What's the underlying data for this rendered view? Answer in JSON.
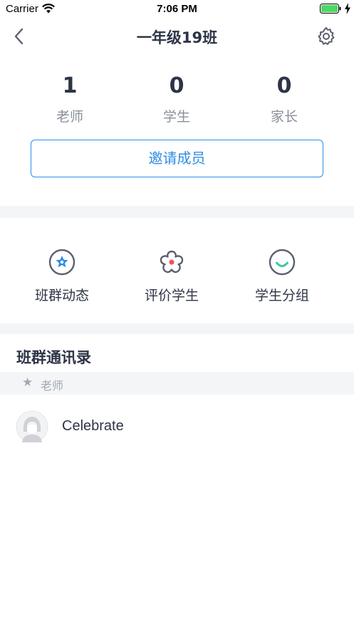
{
  "status_bar": {
    "carrier": "Carrier",
    "time": "7:06 PM"
  },
  "nav": {
    "title": "一年级19班",
    "back_icon": "chevron-left-icon",
    "settings_icon": "gear-icon"
  },
  "stats": [
    {
      "value": "1",
      "label": "老师"
    },
    {
      "value": "0",
      "label": "学生"
    },
    {
      "value": "0",
      "label": "家长"
    }
  ],
  "invite_button": "邀请成员",
  "features": [
    {
      "label": "班群动态",
      "icon": "star-badge-icon"
    },
    {
      "label": "评价学生",
      "icon": "flower-icon"
    },
    {
      "label": "学生分组",
      "icon": "smile-icon"
    }
  ],
  "contacts": {
    "title": "班群通讯录",
    "group_label": "老师",
    "group_icon": "star-icon",
    "members": [
      {
        "name": "Celebrate",
        "icon": "avatar-icon"
      }
    ]
  },
  "colors": {
    "accent": "#2f8de4",
    "text_primary": "#2d3446",
    "text_secondary": "#8a8f99",
    "divider": "#f4f5f7",
    "flower_dot": "#f0565a",
    "smile": "#3ec7a3",
    "battery": "#4cd964"
  }
}
